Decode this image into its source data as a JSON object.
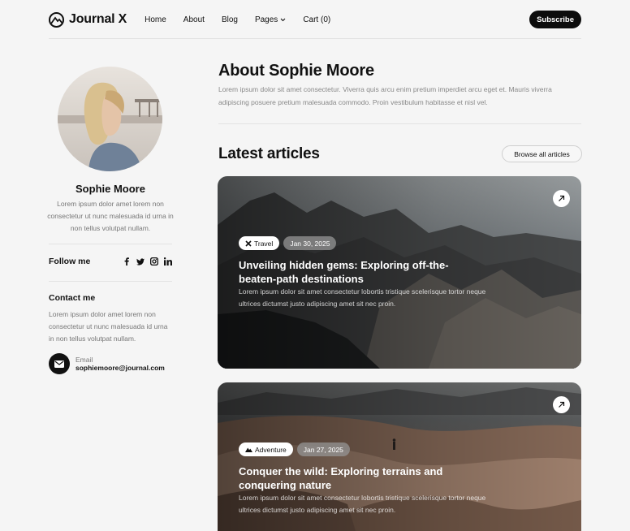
{
  "header": {
    "logo_text": "Journal X",
    "nav": [
      {
        "label": "Home"
      },
      {
        "label": "About"
      },
      {
        "label": "Blog"
      },
      {
        "label": "Pages",
        "has_dropdown": true
      },
      {
        "label": "Cart (0)"
      }
    ],
    "subscribe_label": "Subscribe"
  },
  "sidebar": {
    "name": "Sophie Moore",
    "bio": "Lorem ipsum dolor amet lorem non consectetur ut nunc malesuada id urna in non tellus volutpat nullam.",
    "follow_label": "Follow me",
    "socials": [
      "facebook-icon",
      "twitter-icon",
      "instagram-icon",
      "linkedin-icon"
    ],
    "contact_title": "Contact me",
    "contact_text": "Lorem ipsum dolor amet lorem non consectetur ut nunc malesuada id urna in non tellus volutpat nullam.",
    "email_label": "Email",
    "email_value": "sophiemoore@journal.com"
  },
  "main": {
    "about_title": "About Sophie Moore",
    "about_text": "Lorem ipsum dolor sit amet consectetur. Viverra quis arcu enim pretium imperdiet arcu eget et. Mauris viverra adipiscing posuere pretium malesuada commodo. Proin vestibulum habitasse et nisl vel.",
    "latest_title": "Latest articles",
    "browse_label": "Browse all articles",
    "articles": [
      {
        "category": "Travel",
        "category_icon": "plane-icon",
        "date": "Jan 30, 2025",
        "title": "Unveiling hidden gems: Exploring off-the-beaten-path destinations",
        "excerpt": "Lorem ipsum dolor sit amet consectetur lobortis tristique scelerisque tortor neque ultrices dictumst justo adipiscing amet sit nec proin."
      },
      {
        "category": "Adventure",
        "category_icon": "mountain-icon",
        "date": "Jan 27, 2025",
        "title": "Conquer the wild: Exploring terrains and conquering nature",
        "excerpt": "Lorem ipsum dolor sit amet consectetur lobortis tristique scelerisque tortor neque ultrices dictumst justo adipiscing amet sit nec proin."
      }
    ]
  }
}
